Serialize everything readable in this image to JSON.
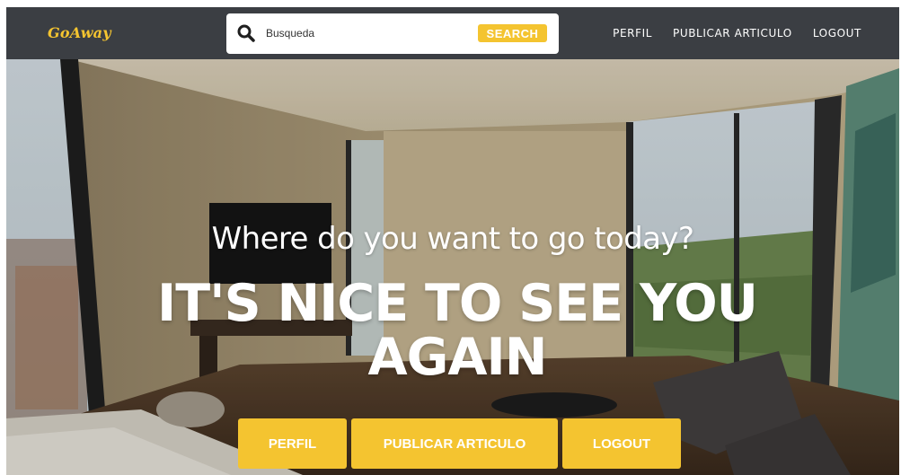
{
  "navbar": {
    "brand": "GoAway",
    "search": {
      "placeholder": "Busqueda",
      "value": "",
      "button_label": "SEARCH"
    },
    "links": [
      "PERFIL",
      "PUBLICAR ARTICULO",
      "LOGOUT"
    ]
  },
  "hero": {
    "subtitle": "Where do you want to go today?",
    "title": "IT'S NICE TO SEE YOU AGAIN",
    "buttons": [
      "PERFIL",
      "PUBLICAR ARTICULO",
      "LOGOUT"
    ]
  },
  "icons": {
    "search": "search-icon"
  },
  "colors": {
    "accent": "#f4c430",
    "navbar_bg": "#3b3e43",
    "text_light": "#ffffff"
  }
}
